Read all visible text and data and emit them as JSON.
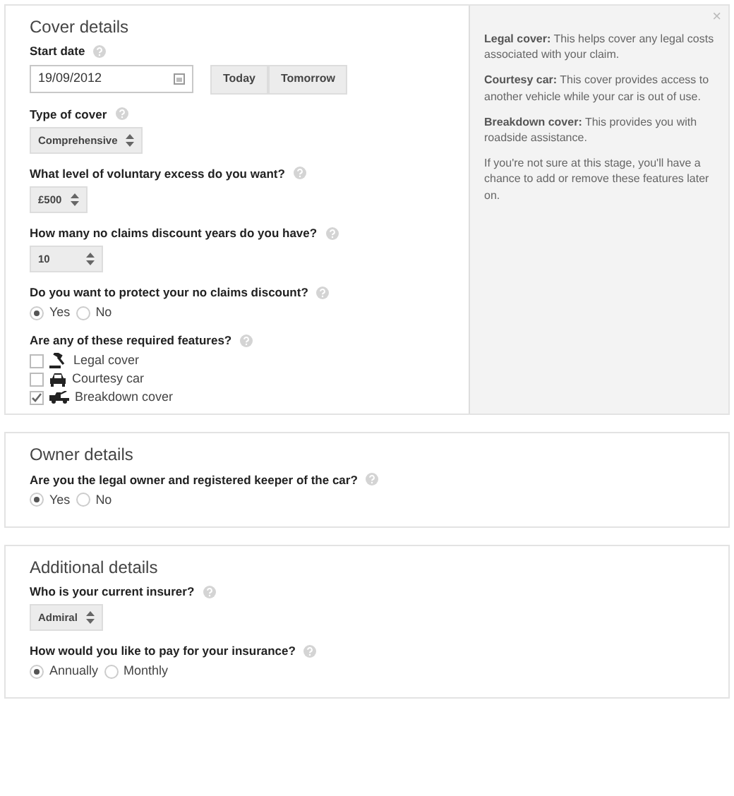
{
  "sections": [
    {
      "title": "Cover details",
      "fields": [
        {
          "kind": "date",
          "label": "Start date",
          "value": "19/09/2012",
          "buttons": [
            "Today",
            "Tomorrow"
          ]
        },
        {
          "kind": "select",
          "label": "Type of cover",
          "value": "Comprehensive"
        },
        {
          "kind": "select",
          "label": "What level of voluntary excess do you want?",
          "value": "£500"
        },
        {
          "kind": "select",
          "label": "How many no claims discount years do you have?",
          "value": "10"
        },
        {
          "kind": "radio",
          "label": "Do you want to protect your no claims discount?",
          "options": [
            {
              "label": "Yes",
              "selected": true
            },
            {
              "label": "No",
              "selected": false
            }
          ]
        },
        {
          "kind": "checks",
          "label": "Are any of these required features?",
          "options": [
            {
              "label": "Legal cover",
              "checked": false
            },
            {
              "label": "Courtesy car",
              "checked": false
            },
            {
              "label": "Breakdown cover",
              "checked": true
            }
          ]
        }
      ],
      "help": {
        "close": "×",
        "paragraphs": [
          "**Legal cover:** This helps cover any legal costs associated with your claim.",
          "**Courtesy car:** This cover provides access to another vehicle while your car is out of use.",
          "**Breakdown cover:** This provides you with roadside assistance.",
          "If you're not sure at this stage, you'll have a chance to add or remove these features later on."
        ]
      }
    },
    {
      "title": "Owner details",
      "fields": [
        {
          "kind": "radio",
          "label": "Are you the legal owner and registered keeper of the car?",
          "options": [
            {
              "label": "Yes",
              "selected": true
            },
            {
              "label": "No",
              "selected": false
            }
          ]
        }
      ]
    },
    {
      "title": "Additional details",
      "fields": [
        {
          "kind": "select",
          "label": "Who is your current insurer?",
          "value": "Admiral"
        },
        {
          "kind": "radio",
          "label": "How would you like to pay for your insurance?",
          "options": [
            {
              "label": "Annually",
              "selected": true
            },
            {
              "label": "Monthly",
              "selected": false
            }
          ]
        }
      ]
    }
  ]
}
